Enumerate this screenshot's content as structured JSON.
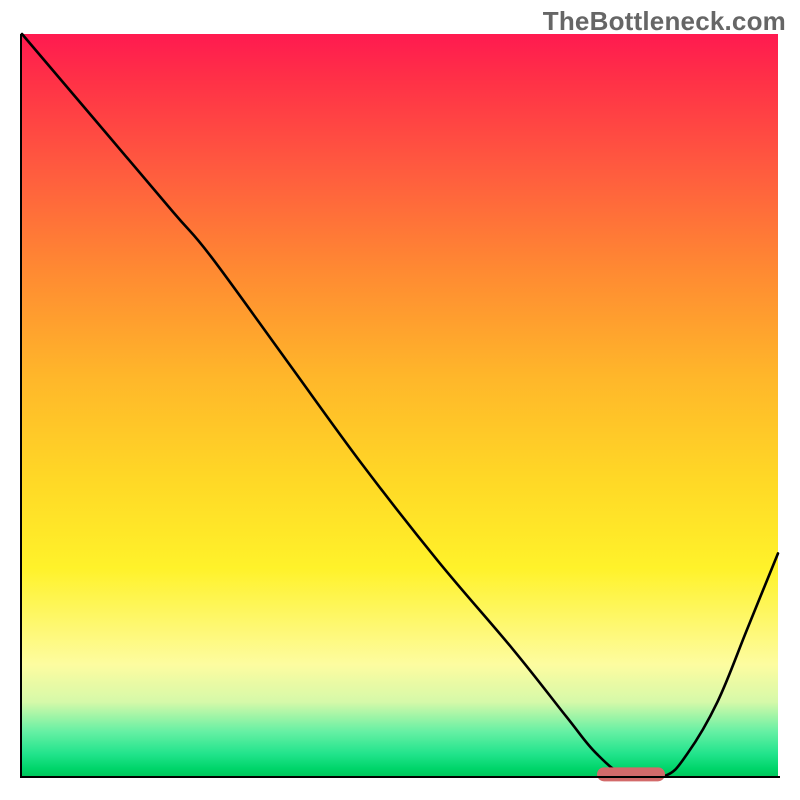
{
  "watermark": "TheBottleneck.com",
  "colors": {
    "watermark": "#666666",
    "axis": "#000000",
    "curve": "#000000",
    "marker": "#d36a6a",
    "gradient_top": "#ff1a50",
    "gradient_mid_orange": "#ff8a32",
    "gradient_mid_yellow": "#fff22a",
    "gradient_pale": "#fdfca0",
    "gradient_green": "#00d56a"
  },
  "chart_data": {
    "type": "line",
    "title": "",
    "xlabel": "",
    "ylabel": "",
    "xlim": [
      0,
      100
    ],
    "ylim": [
      0,
      100
    ],
    "grid": false,
    "legend": false,
    "background": "vertical-gradient red→orange→yellow→green",
    "series": [
      {
        "name": "bottleneck-curve",
        "x": [
          0,
          10,
          20,
          25,
          35,
          45,
          55,
          65,
          72,
          76,
          80,
          85,
          88,
          92,
          96,
          100
        ],
        "values": [
          100,
          88,
          76,
          70,
          56,
          42,
          29,
          17,
          8,
          3,
          0,
          0,
          3,
          10,
          20,
          30
        ]
      }
    ],
    "annotations": [
      {
        "name": "optimal-range-marker",
        "shape": "rounded-bar",
        "x_start": 76,
        "x_end": 85,
        "y": 0,
        "color": "#d36a6a"
      }
    ]
  }
}
